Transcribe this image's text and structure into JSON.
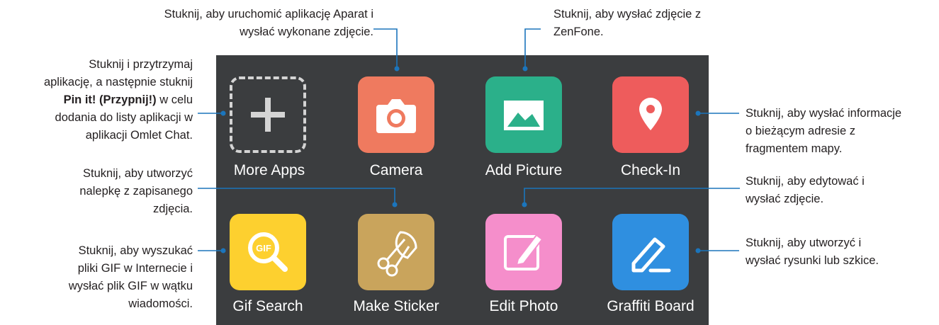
{
  "apps": [
    {
      "label": "More Apps",
      "icon": "plus-icon"
    },
    {
      "label": "Camera",
      "icon": "camera-icon",
      "color": "#ef7a5f"
    },
    {
      "label": "Add Picture",
      "icon": "image-icon",
      "color": "#2bb08a"
    },
    {
      "label": "Check-In",
      "icon": "location-pin-icon",
      "color": "#ee5c5c"
    },
    {
      "label": "Gif Search",
      "icon": "gif-search-icon",
      "color": "#fdd02f"
    },
    {
      "label": "Make Sticker",
      "icon": "scissors-icon",
      "color": "#c9a45c"
    },
    {
      "label": "Edit Photo",
      "icon": "edit-icon",
      "color": "#f58ecb"
    },
    {
      "label": "Graffiti Board",
      "icon": "pen-icon",
      "color": "#2f8fe0"
    }
  ],
  "callouts": {
    "camera": [
      "Stuknij, aby uruchomić aplikację Aparat i",
      "wysłać wykonane zdjęcie."
    ],
    "add_picture": [
      "Stuknij, aby wysłać zdjęcie z",
      "ZenFone."
    ],
    "more_apps_lines": [
      "Stuknij i przytrzymaj",
      "aplikację, a następnie stuknij"
    ],
    "more_apps_bold": "Pin it! (Przypnij!)",
    "more_apps_after_bold": " w celu",
    "more_apps_tail": [
      "dodania do listy aplikacji w",
      "aplikacji Omlet Chat."
    ],
    "check_in": [
      "Stuknij, aby wysłać informacje",
      "o bieżącym adresie z",
      "fragmentem mapy."
    ],
    "make_sticker": [
      "Stuknij, aby utworzyć",
      "nalepkę z zapisanego",
      "zdjęcia."
    ],
    "edit_photo": [
      "Stuknij, aby edytować i",
      "wysłać zdjęcie."
    ],
    "gif_search": [
      "Stuknij, aby wyszukać",
      "pliki GIF w Internecie i",
      "wysłać plik GIF w wątku",
      "wiadomości."
    ],
    "graffiti": [
      "Stuknij, aby utworzyć i",
      "wysłać rysunki lub szkice."
    ]
  },
  "colors": {
    "panel": "#3b3d3f",
    "leader": "#1b75bc"
  }
}
